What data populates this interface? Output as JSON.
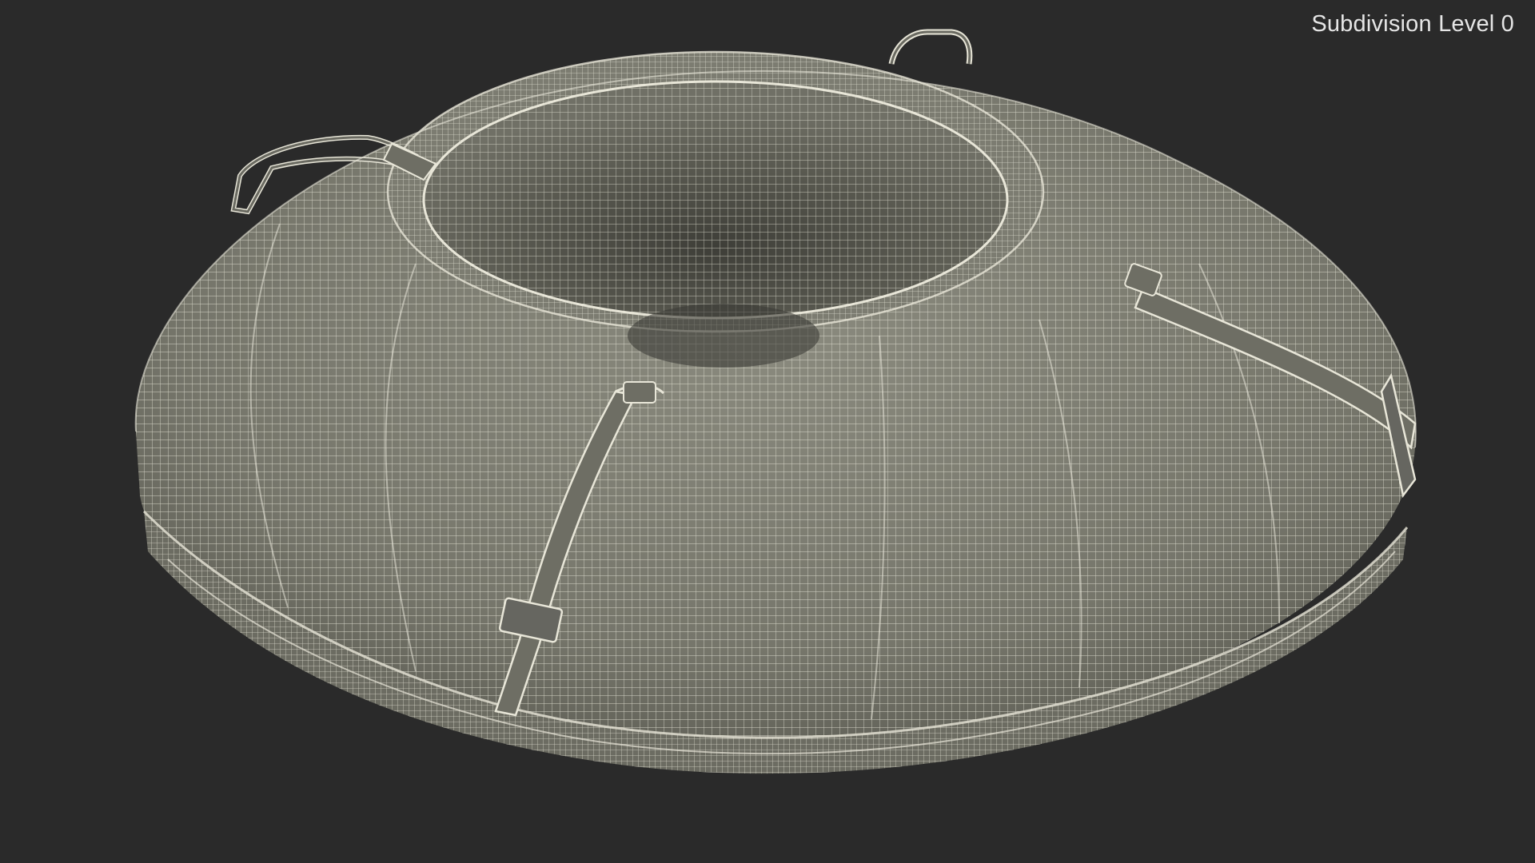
{
  "viewport": {
    "subdivision_label": "Subdivision Level 0",
    "background_color": "#2a2a2a",
    "model_color": "#7d7d72",
    "wire_color": "#e8e6d8"
  },
  "model": {
    "name": "snow-tube",
    "icon": "inflatable-snow-tube-wireframe"
  }
}
